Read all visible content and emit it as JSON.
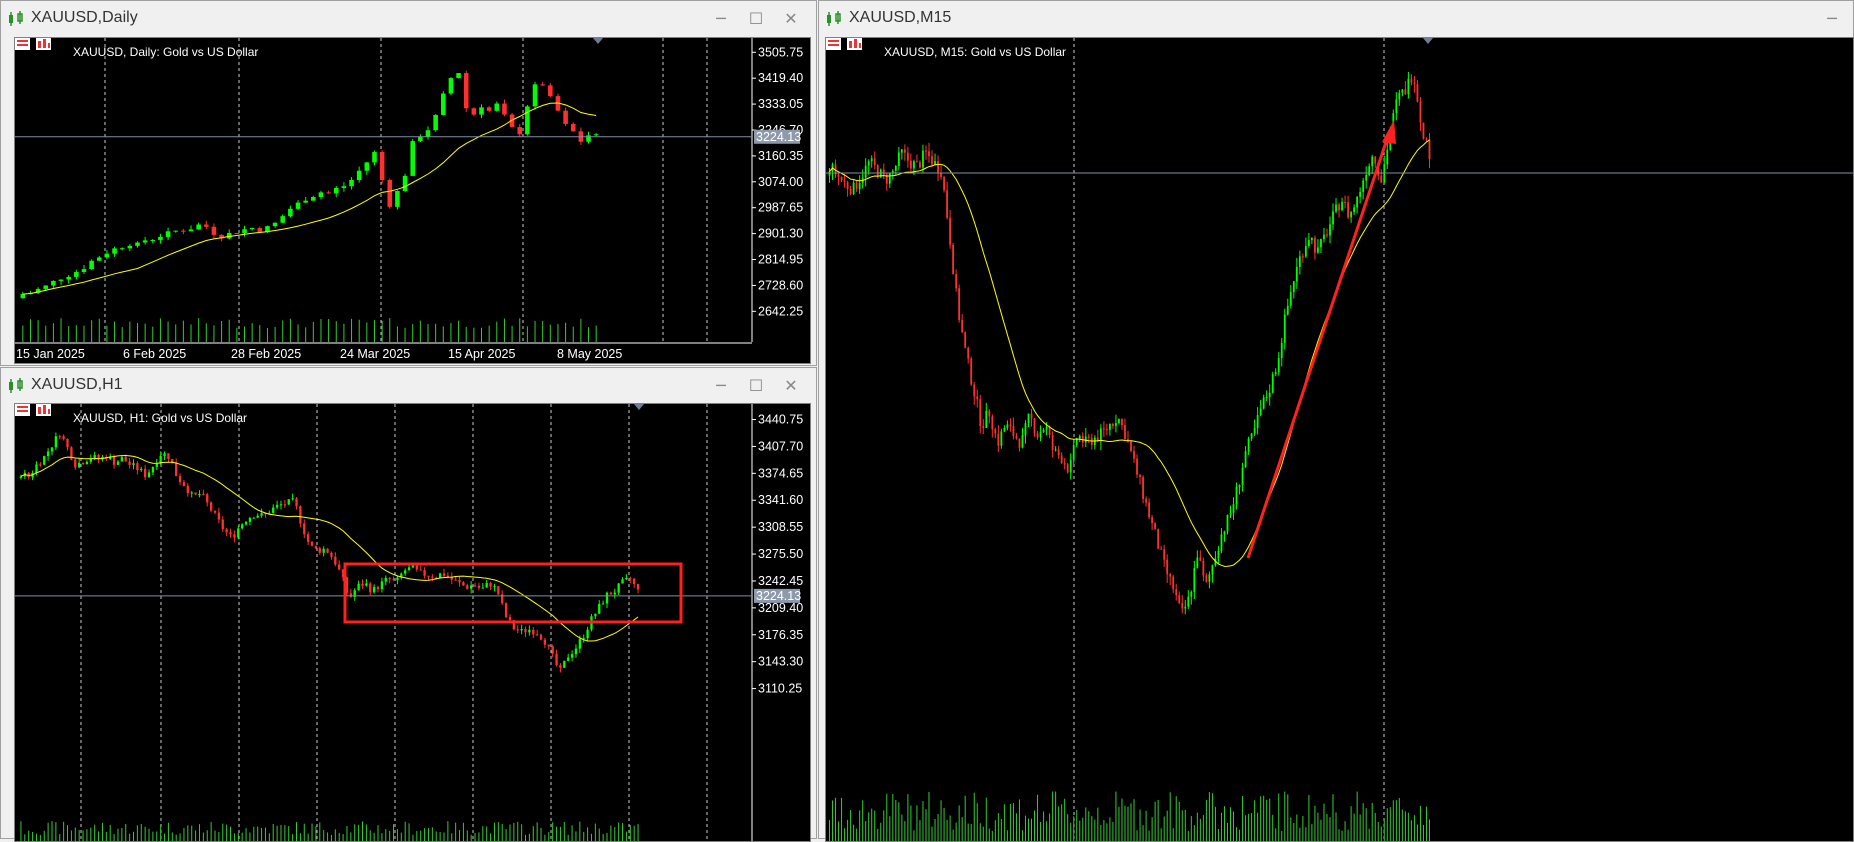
{
  "windows": {
    "daily": {
      "title": "XAUUSD,Daily",
      "label": "XAUUSD, Daily:  Gold vs US Dollar",
      "price_labels": [
        "3505.75",
        "3419.40",
        "3333.05",
        "3246.70",
        "3160.35",
        "3074.00",
        "2987.65",
        "2901.30",
        "2814.95",
        "2728.60",
        "2642.25"
      ],
      "current_price": "3224.13",
      "date_labels": [
        "15 Jan 2025",
        "6 Feb 2025",
        "28 Feb 2025",
        "24 Mar 2025",
        "15 Apr 2025",
        "8 May 2025"
      ]
    },
    "h1": {
      "title": "XAUUSD,H1",
      "label": "XAUUSD, H1:  Gold vs US Dollar",
      "price_labels": [
        "3440.75",
        "3407.70",
        "3374.65",
        "3341.60",
        "3308.55",
        "3275.50",
        "3242.45",
        "3209.40",
        "3176.35",
        "3143.30",
        "3110.25"
      ],
      "current_price": "3224.13"
    },
    "m15": {
      "title": "XAUUSD,M15",
      "label": "XAUUSD, M15:  Gold vs US Dollar"
    }
  },
  "window_buttons": {
    "minimize": "─",
    "maximize": "☐",
    "close": "✕"
  },
  "colors": {
    "chart_bg": "#000000",
    "bull": "#00ff00",
    "bear": "#ff3030",
    "ma": "#ffff00",
    "grid": "#ffffff",
    "price_line": "#7f8fa6",
    "annotation": "#ff2020",
    "volume": "#33cc33"
  },
  "chart_data": [
    {
      "type": "candlestick",
      "symbol": "XAUUSD",
      "timeframe": "Daily",
      "ylim": [
        2600,
        3540
      ],
      "x_labels": [
        "15 Jan 2025",
        "6 Feb 2025",
        "28 Feb 2025",
        "24 Mar 2025",
        "15 Apr 2025",
        "8 May 2025"
      ],
      "close_path": [
        2700,
        2705,
        2715,
        2725,
        2740,
        2755,
        2765,
        2775,
        2790,
        2810,
        2825,
        2840,
        2850,
        2860,
        2870,
        2862,
        2880,
        2885,
        2895,
        2900,
        2910,
        2915,
        2920,
        2930,
        2925,
        2905,
        2895,
        2900,
        2910,
        2915,
        2920,
        2915,
        2920,
        2935,
        2960,
        2985,
        3000,
        3020,
        3030,
        3040,
        3035,
        3050,
        3060,
        3080,
        3110,
        3140,
        3170,
        3080,
        3000,
        3040,
        3100,
        3200,
        3230,
        3250,
        3290,
        3360,
        3420,
        3440,
        3320,
        3300,
        3330,
        3310,
        3330,
        3290,
        3250,
        3240,
        3330,
        3390,
        3400,
        3350,
        3310,
        3260,
        3240,
        3210,
        3230,
        3224
      ],
      "ma": [
        2660,
        2690,
        2720,
        2750,
        2780,
        2810,
        2840,
        2870,
        2890,
        2900,
        2920,
        2950,
        2990,
        3040,
        3090,
        3130,
        3180,
        3230,
        3270,
        3300,
        3325,
        3320
      ],
      "current_price": 3224.13
    },
    {
      "type": "candlestick",
      "symbol": "XAUUSD",
      "timeframe": "H1",
      "ylim": [
        3095,
        3450
      ],
      "close_path": [
        3375,
        3370,
        3385,
        3395,
        3410,
        3425,
        3405,
        3385,
        3390,
        3395,
        3392,
        3396,
        3388,
        3393,
        3385,
        3380,
        3372,
        3385,
        3400,
        3395,
        3370,
        3360,
        3345,
        3350,
        3335,
        3320,
        3305,
        3295,
        3310,
        3320,
        3325,
        3322,
        3330,
        3335,
        3338,
        3340,
        3310,
        3285,
        3280,
        3282,
        3270,
        3250,
        3220,
        3235,
        3240,
        3230,
        3238,
        3245,
        3240,
        3255,
        3258,
        3252,
        3250,
        3248,
        3252,
        3245,
        3240,
        3235,
        3238,
        3232,
        3240,
        3230,
        3200,
        3185,
        3180,
        3183,
        3180,
        3170,
        3150,
        3130,
        3150,
        3160,
        3175,
        3195,
        3210,
        3225,
        3230,
        3240,
        3245,
        3230
      ],
      "current_price": 3224.13,
      "annotation": "rectangle"
    },
    {
      "type": "candlestick",
      "symbol": "XAUUSD",
      "timeframe": "M15",
      "close_path": [
        3305,
        3295,
        3285,
        3280,
        3295,
        3310,
        3300,
        3290,
        3300,
        3320,
        3310,
        3305,
        3320,
        3310,
        3300,
        3230,
        3150,
        3100,
        3060,
        3020,
        3035,
        3000,
        3020,
        3010,
        3000,
        3030,
        3010,
        3020,
        2990,
        2985,
        2970,
        3010,
        3000,
        3005,
        3010,
        3020,
        3030,
        3010,
        2980,
        2950,
        2920,
        2890,
        2860,
        2840,
        2810,
        2830,
        2880,
        2840,
        2870,
        2900,
        2920,
        2950,
        2990,
        3010,
        3040,
        3060,
        3090,
        3140,
        3180,
        3210,
        3230,
        3210,
        3230,
        3250,
        3270,
        3250,
        3270,
        3300,
        3320,
        3290,
        3340,
        3380,
        3390,
        3410,
        3350,
        3320
      ],
      "annotation": "arrow"
    }
  ]
}
